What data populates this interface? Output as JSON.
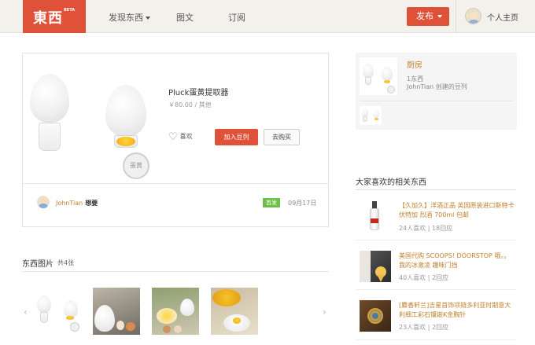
{
  "header": {
    "logo_text": "東西",
    "logo_badge": "BETA",
    "nav": [
      {
        "label": "发现东西",
        "has_dropdown": true
      },
      {
        "label": "图文",
        "has_dropdown": false
      },
      {
        "label": "订阅",
        "has_dropdown": false
      }
    ],
    "publish_label": "发布",
    "profile_label": "个人主页"
  },
  "product": {
    "title": "Pluck蛋黄提取器",
    "price": "￥80.00 / 其他",
    "badge_text": "蛋黄",
    "like_label": "喜欢",
    "add_to_list_label": "加入豆列",
    "buy_label": "去购买",
    "poster": {
      "name": "JohnTian",
      "action": "想要",
      "tag": "首发",
      "date": "09月17日"
    }
  },
  "images_section": {
    "title": "东西图片",
    "count": "共4张",
    "prev_arrow": "‹",
    "next_arrow": "›"
  },
  "doulist": {
    "name": "厨房",
    "item_count": "1东西",
    "creator": "JohnTian 创建的豆列"
  },
  "related": {
    "title": "大家喜欢的相关东西",
    "items": [
      {
        "title": "【久加久】洋酒正品 英国原装进口斯特卡伏特加 烈酒 700ml 包邮",
        "likes": "24人喜欢",
        "replies": "18回应"
      },
      {
        "title": "美国代购 SCOOPS! DOORSTOP 哦。。我的冰激凌 趣味门挡",
        "likes": "40人喜欢",
        "replies": "2回应"
      },
      {
        "title": "[麝香轩兰]吉星首饰项链多利亚时期意大利细工彩石镶嵌K金胸针",
        "likes": "23人喜欢",
        "replies": "2回应"
      }
    ]
  },
  "colors": {
    "brand_red": "#e0513a",
    "link_brown": "#c0812d",
    "tag_green": "#6cbf47"
  }
}
